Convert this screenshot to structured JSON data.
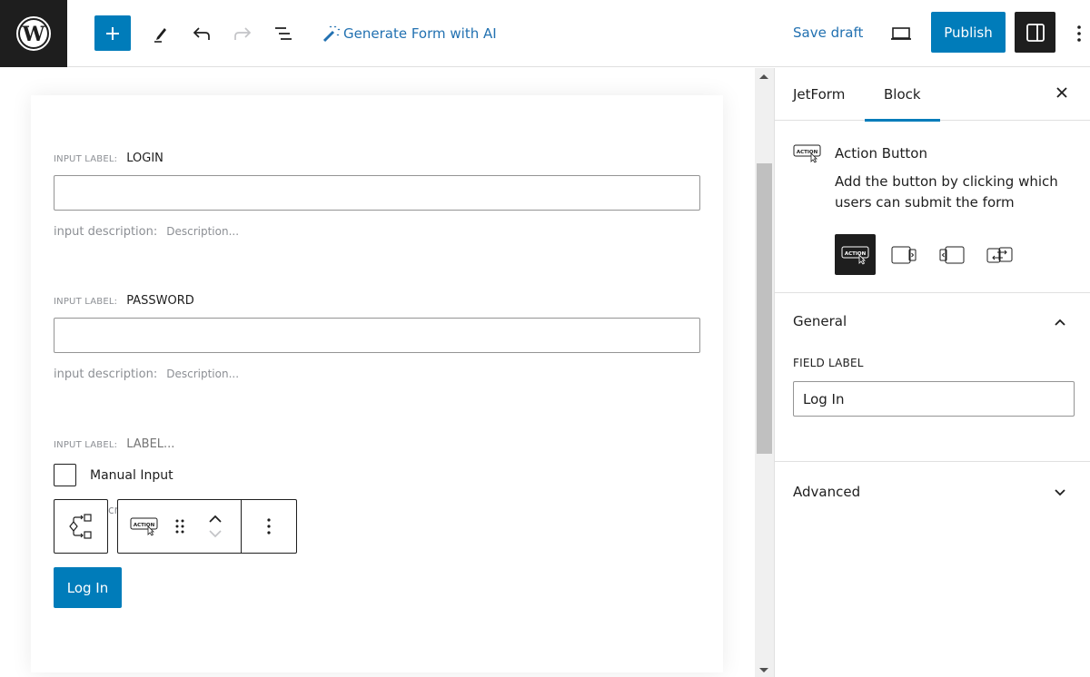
{
  "topbar": {
    "logo": "wordpress-logo",
    "add_block_icon": "plus-icon",
    "tools_icon": "pencil-icon",
    "undo_icon": "undo-icon",
    "redo_icon": "redo-icon",
    "list_view_icon": "list-view-icon",
    "generate_ai_label": "Generate Form with AI",
    "save_draft_label": "Save draft",
    "preview_icon": "laptop-icon",
    "publish_label": "Publish",
    "settings_icon": "sidebar-toggle-icon",
    "options_icon": "more-vertical-icon"
  },
  "form": {
    "fields": [
      {
        "label_key": "INPUT LABEL:",
        "label_value": "LOGIN",
        "input_value": "",
        "desc_key": "input description:",
        "desc_placeholder": "Description..."
      },
      {
        "label_key": "INPUT LABEL:",
        "label_value": "PASSWORD",
        "input_value": "",
        "desc_key": "input description:",
        "desc_placeholder": "Description..."
      },
      {
        "label_key": "INPUT LABEL:",
        "label_placeholder": "LABEL..."
      }
    ],
    "checkbox": {
      "label": "Manual Input",
      "checked": false
    },
    "hidden_text_fragment": "cri",
    "block_toolbar": {
      "transform_icon": "conditional-branch-icon",
      "block_type_icon": "action-button-icon",
      "block_type_text": "ACTION",
      "drag_icon": "drag-handle-icon",
      "move_up_icon": "chevron-up-icon",
      "move_down_icon": "chevron-down-icon",
      "more_icon": "more-vertical-icon"
    },
    "submit_button_label": "Log In"
  },
  "scrollbar": {
    "position_fraction": 0.16,
    "visible_fraction": 0.48
  },
  "sidebar": {
    "tabs": [
      {
        "label": "JetForm",
        "active": false
      },
      {
        "label": "Block",
        "active": true
      }
    ],
    "close_icon": "close-icon",
    "block": {
      "icon": "action-button-icon",
      "icon_text": "ACTION",
      "title": "Action Button",
      "description": "Add the button by clicking which users can submit the form",
      "variations": [
        {
          "name": "action-button",
          "active": true
        },
        {
          "name": "next-page",
          "active": false
        },
        {
          "name": "prev-page",
          "active": false
        },
        {
          "name": "change-render-state",
          "active": false
        }
      ]
    },
    "panels": {
      "general": {
        "title": "General",
        "expanded": true,
        "field_label_title": "FIELD LABEL",
        "field_label_value": "Log In"
      },
      "advanced": {
        "title": "Advanced",
        "expanded": false
      }
    }
  },
  "colors": {
    "accent": "#007cba",
    "link": "#2271b1",
    "dark": "#1e1e1e",
    "muted": "#8c8f94"
  }
}
